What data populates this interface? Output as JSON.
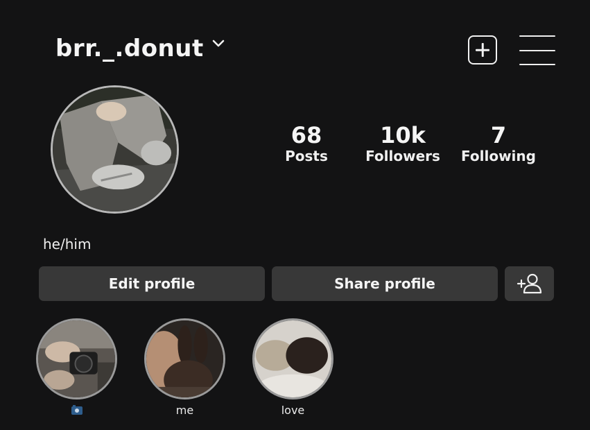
{
  "header": {
    "username": "brr._.donut",
    "new_post_icon": "plus-square-icon",
    "menu_icon": "hamburger-menu-icon"
  },
  "profile": {
    "avatar": "profile-photo",
    "bio": "he/him"
  },
  "stats": {
    "posts": {
      "value": "68",
      "label": "Posts"
    },
    "followers": {
      "value": "10k",
      "label": "Followers"
    },
    "following": {
      "value": "7",
      "label": "Following"
    }
  },
  "actions": {
    "edit_label": "Edit profile",
    "share_label": "Share profile",
    "add_icon": "add-person-icon"
  },
  "highlights": [
    {
      "label_icon": "camera-emoji",
      "label": ""
    },
    {
      "label": "me"
    },
    {
      "label": "love"
    }
  ],
  "colors": {
    "background": "#131314",
    "button_bg": "#383838",
    "text": "#f3f3f3"
  }
}
